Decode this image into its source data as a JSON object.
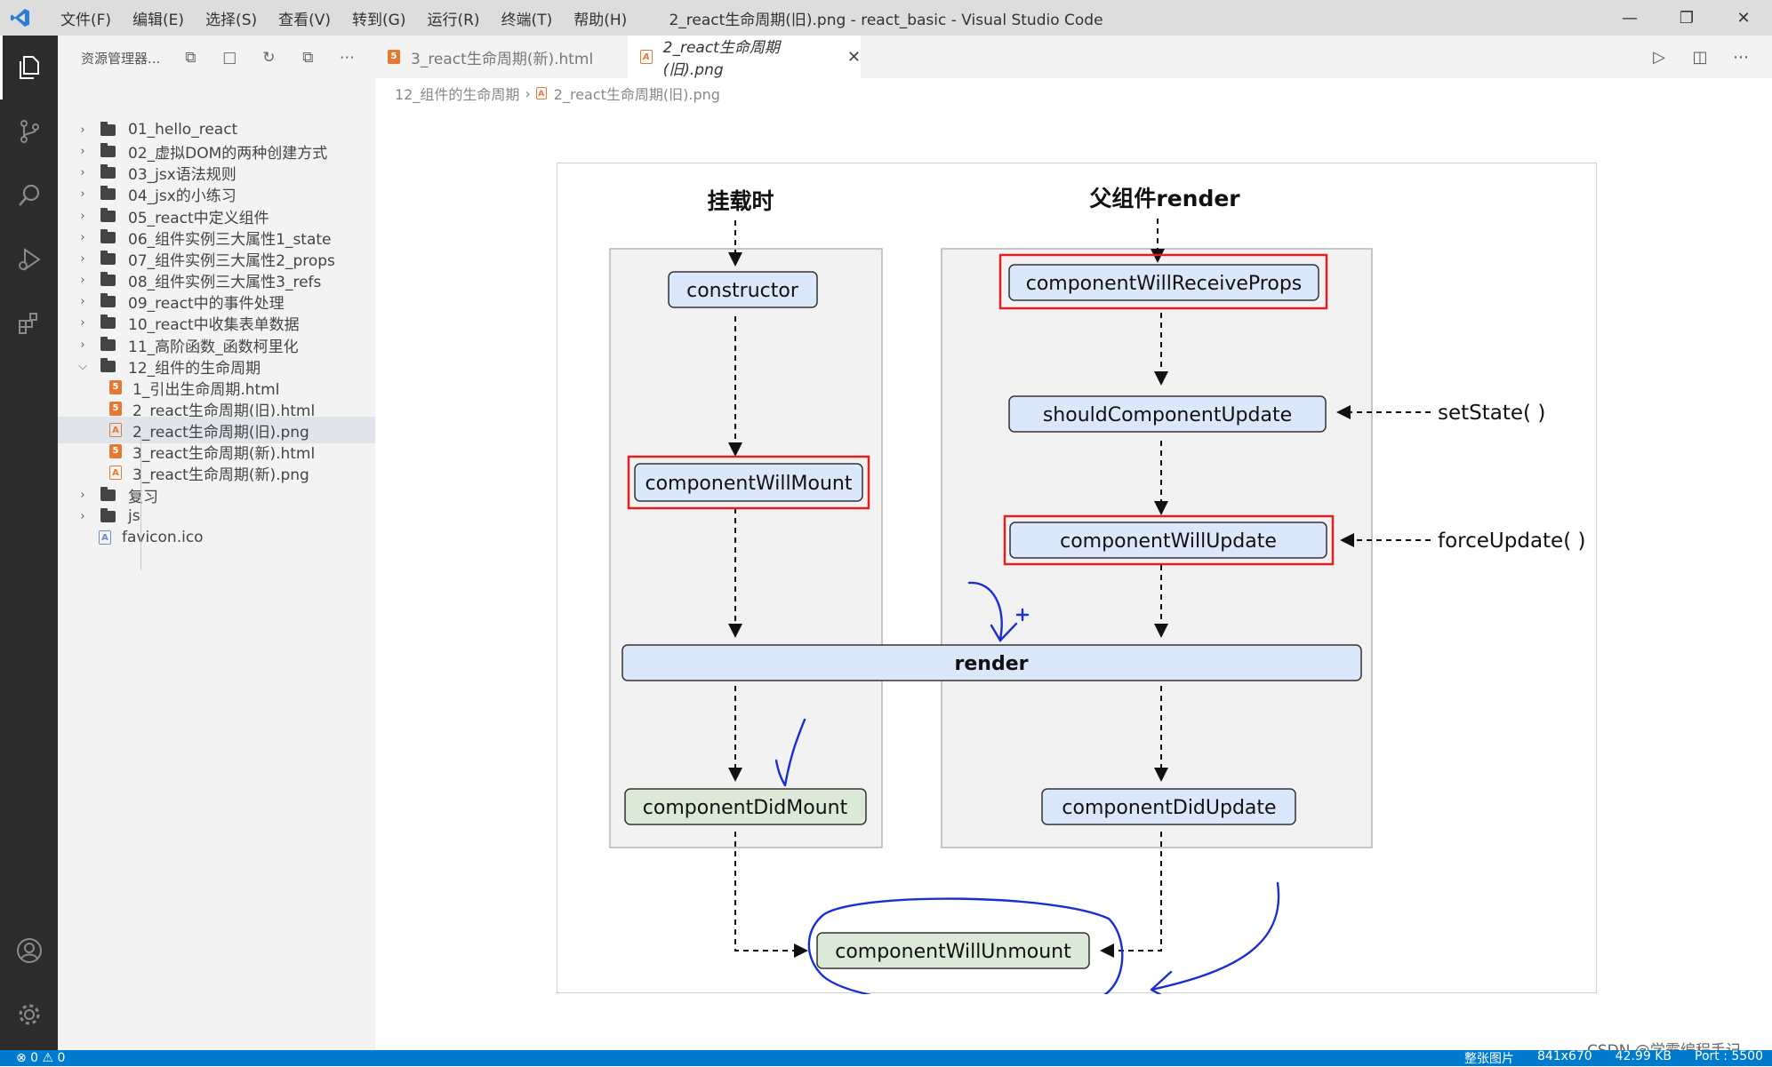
{
  "window": {
    "title": "2_react生命周期(旧).png - react_basic - Visual Studio Code",
    "menu": [
      "文件(F)",
      "编辑(E)",
      "选择(S)",
      "查看(V)",
      "转到(G)",
      "运行(R)",
      "终端(T)",
      "帮助(H)"
    ]
  },
  "sidebar": {
    "title": "资源管理器...",
    "items": [
      {
        "label": "01_hello_react",
        "kind": "folder"
      },
      {
        "label": "02_虚拟DOM的两种创建方式",
        "kind": "folder"
      },
      {
        "label": "03_jsx语法规则",
        "kind": "folder"
      },
      {
        "label": "04_jsx的小练习",
        "kind": "folder"
      },
      {
        "label": "05_react中定义组件",
        "kind": "folder"
      },
      {
        "label": "06_组件实例三大属性1_state",
        "kind": "folder"
      },
      {
        "label": "07_组件实例三大属性2_props",
        "kind": "folder"
      },
      {
        "label": "08_组件实例三大属性3_refs",
        "kind": "folder"
      },
      {
        "label": "09_react中的事件处理",
        "kind": "folder"
      },
      {
        "label": "10_react中收集表单数据",
        "kind": "folder"
      },
      {
        "label": "11_高阶函数_函数柯里化",
        "kind": "folder"
      },
      {
        "label": "12_组件的生命周期",
        "kind": "folder-open"
      },
      {
        "label": "1_引出生命周期.html",
        "kind": "html"
      },
      {
        "label": "2_react生命周期(旧).html",
        "kind": "html"
      },
      {
        "label": "2_react生命周期(旧).png",
        "kind": "png",
        "selected": true
      },
      {
        "label": "3_react生命周期(新).html",
        "kind": "html"
      },
      {
        "label": "3_react生命周期(新).png",
        "kind": "png"
      },
      {
        "label": "复习",
        "kind": "folder"
      },
      {
        "label": "js",
        "kind": "folder"
      },
      {
        "label": "favicon.ico",
        "kind": "ico"
      }
    ]
  },
  "tabs": [
    {
      "label": "3_react生命周期(新).html",
      "active": false
    },
    {
      "label": "2_react生命周期(旧).png",
      "active": true
    }
  ],
  "breadcrumb": {
    "folder": "12_组件的生命周期",
    "file": "2_react生命周期(旧).png"
  },
  "diagram": {
    "mount_title": "挂载时",
    "update_title": "父组件render",
    "constructor": "constructor",
    "componentWillMount": "componentWillMount",
    "componentDidMount": "componentDidMount",
    "componentWillReceiveProps": "componentWillReceiveProps",
    "shouldComponentUpdate": "shouldComponentUpdate",
    "componentWillUpdate": "componentWillUpdate",
    "render": "render",
    "componentDidUpdate": "componentDidUpdate",
    "componentWillUnmount": "componentWillUnmount",
    "setState": "setState( )",
    "forceUpdate": "forceUpdate( )"
  },
  "statusbar": {
    "errors": "⊗ 0 ⚠ 0",
    "image_kind": "整张图片",
    "dimensions": "841x670",
    "size": "42.99 KB",
    "port": "Port : 5500"
  },
  "watermark": "CSDN @学霸编程手记",
  "colors": {
    "accent": "#007acc",
    "node_fill": "#dbe7fb",
    "node_green": "#dbead6",
    "highlight_red": "#e02020",
    "ink_blue": "#1a2fd1"
  }
}
